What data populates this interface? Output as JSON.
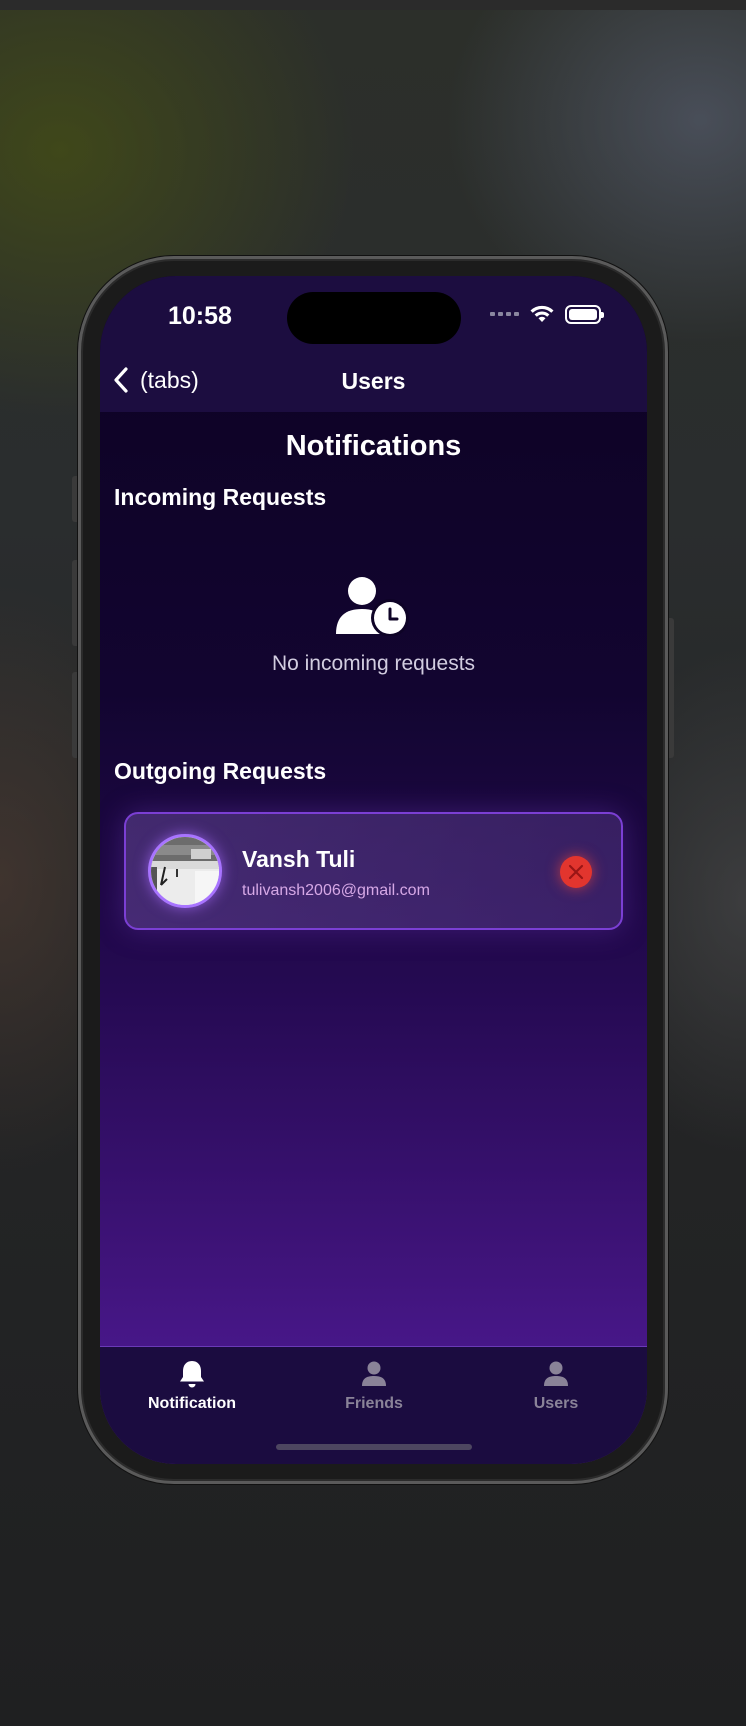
{
  "status_bar": {
    "time": "10:58"
  },
  "nav": {
    "back_label": "(tabs)",
    "title": "Users"
  },
  "page": {
    "title": "Notifications"
  },
  "incoming": {
    "section_title": "Incoming Requests",
    "empty_text": "No incoming requests",
    "empty_icon": "user-clock-icon"
  },
  "outgoing": {
    "section_title": "Outgoing Requests",
    "requests": [
      {
        "name": "Vansh Tuli",
        "email": "tulivansh2006@gmail.com",
        "action_icon": "close-icon"
      }
    ]
  },
  "tabs": [
    {
      "label": "Notification",
      "icon": "bell-icon",
      "active": true
    },
    {
      "label": "Friends",
      "icon": "person-icon",
      "active": false
    },
    {
      "label": "Users",
      "icon": "person-icon",
      "active": false
    }
  ],
  "colors": {
    "accent": "#7b3fd4",
    "header_bg": "#1c0d40",
    "cancel_red": "#e2352e",
    "tab_active": "#ffffff",
    "tab_inactive": "#8a8398"
  }
}
